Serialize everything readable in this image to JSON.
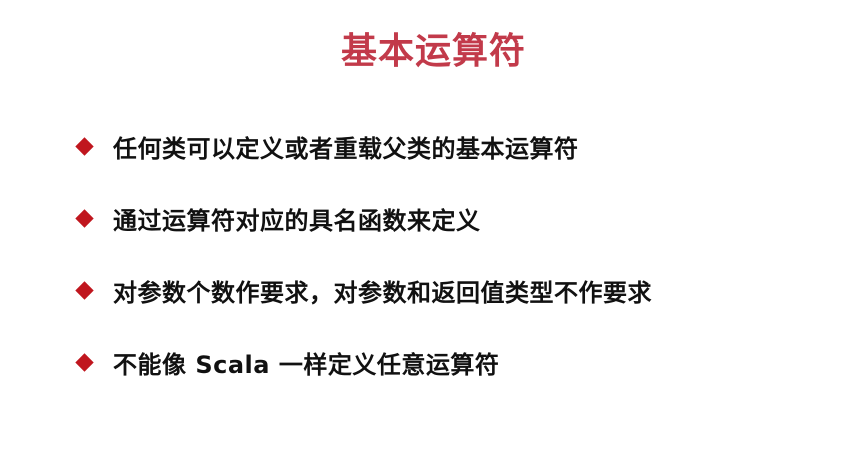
{
  "slide": {
    "title": "基本运算符",
    "bullets": [
      {
        "text": "任何类可以定义或者重载父类的基本运算符"
      },
      {
        "text": "通过运算符对应的具名函数来定义"
      },
      {
        "text": "对参数个数作要求，对参数和返回值类型不作要求"
      },
      {
        "text": "不能像 Scala 一样定义任意运算符"
      }
    ]
  },
  "colors": {
    "title": "#c23a4a",
    "bullet_marker": "#c0161e",
    "text": "#111111",
    "background": "#ffffff"
  }
}
